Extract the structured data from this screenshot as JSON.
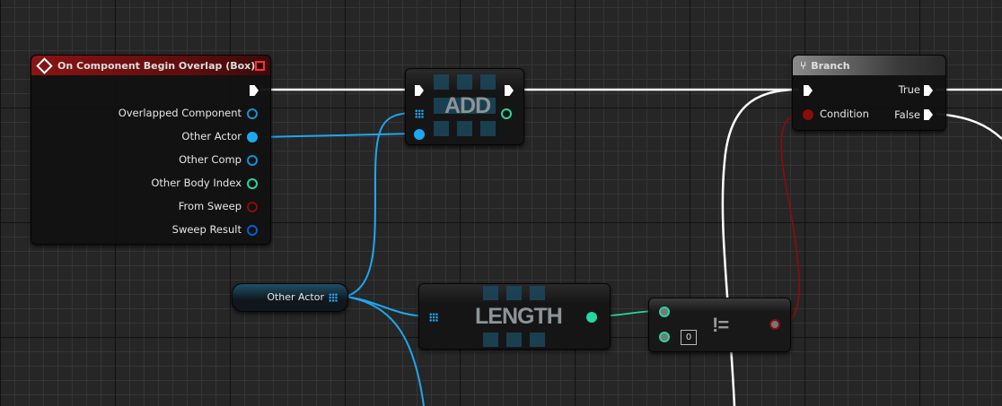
{
  "event_node": {
    "title": "On Component Begin Overlap (Box)",
    "pins": [
      {
        "label": "Overlapped Component",
        "color": "#1a8fd6",
        "connected": false
      },
      {
        "label": "Other Actor",
        "color": "#1ea7f0",
        "connected": true
      },
      {
        "label": "Other Comp",
        "color": "#1a8fd6",
        "connected": false
      },
      {
        "label": "Other Body Index",
        "color": "#27d6a0",
        "connected": false
      },
      {
        "label": "From Sweep",
        "color": "#8a0c0c",
        "connected": false
      },
      {
        "label": "Sweep Result",
        "color": "#0d5bd6",
        "connected": false
      }
    ]
  },
  "add_node": {
    "title": "ADD"
  },
  "length_node": {
    "title": "LENGTH"
  },
  "not_equal_node": {
    "title": "!=",
    "default_value": "0"
  },
  "branch_node": {
    "title": "Branch",
    "condition_label": "Condition",
    "true_label": "True",
    "false_label": "False"
  },
  "variable_node": {
    "label": "Other Actor"
  },
  "colors": {
    "exec": "#ffffff",
    "object": "#1ea7f0",
    "integer": "#27d6a0",
    "boolean": "#8a0c0c",
    "event_header": "#8a1414"
  }
}
